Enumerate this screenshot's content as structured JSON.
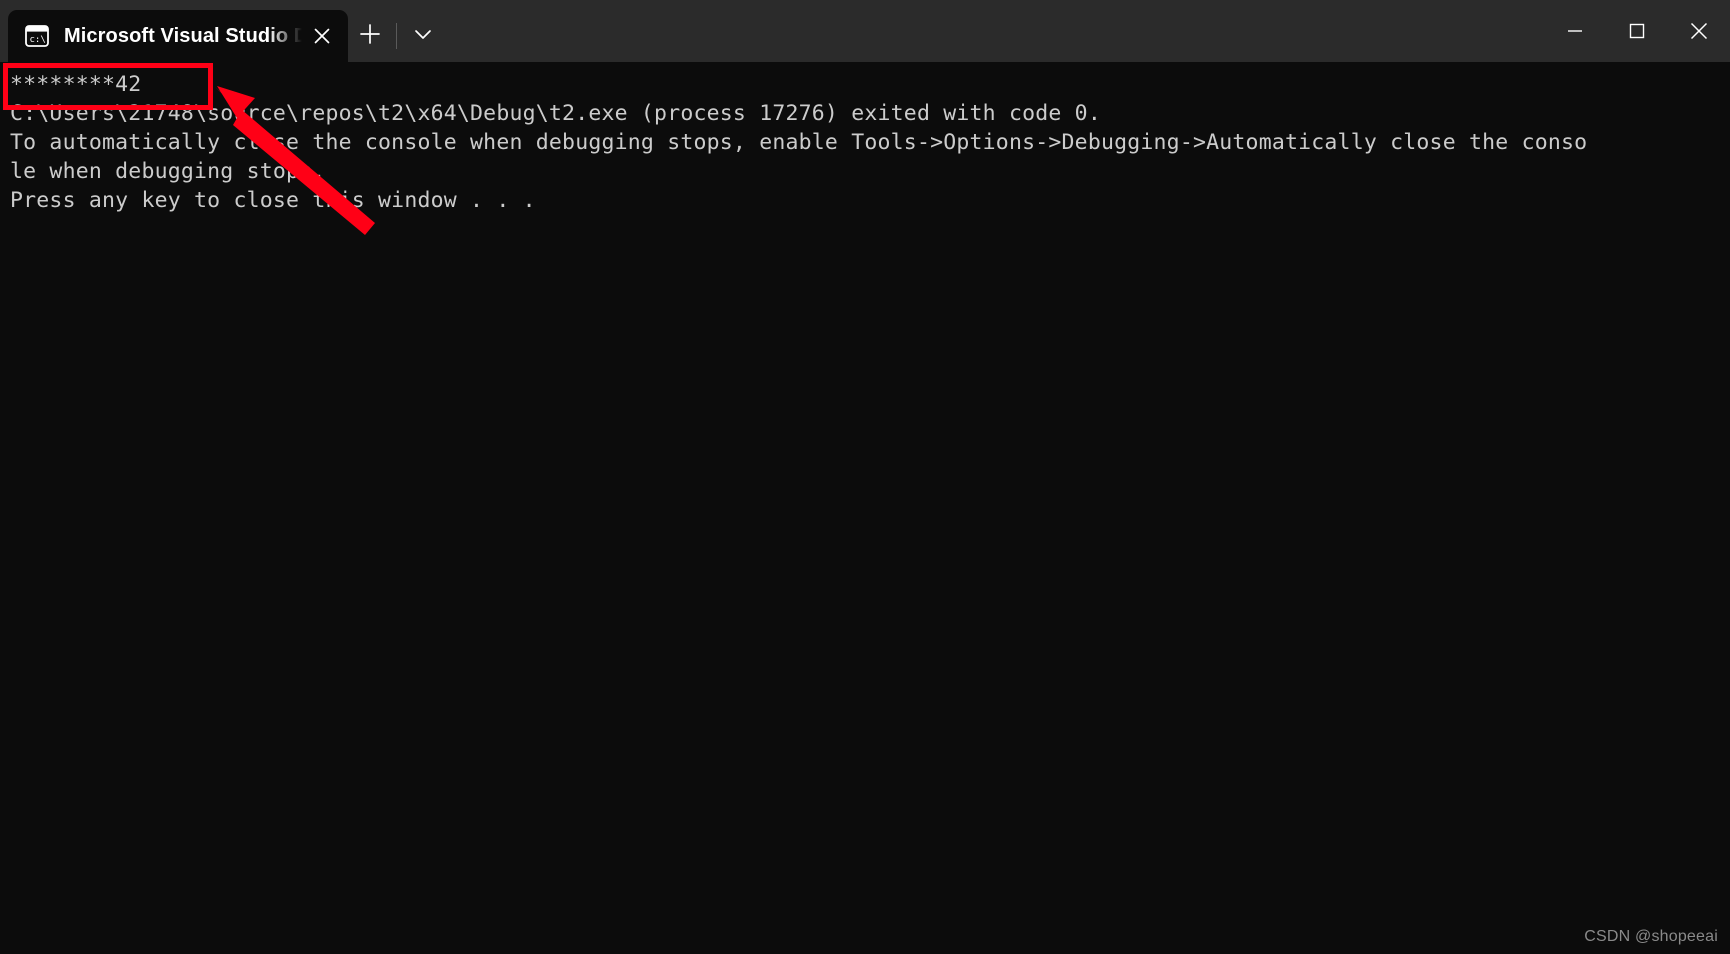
{
  "window": {
    "tab": {
      "title": "Microsoft Visual Studio Debug",
      "icon": "console-cmd-icon",
      "close_label": "Close tab"
    },
    "new_tab_label": "New tab",
    "dropdown_label": "Open a new tab dropdown",
    "minimize_label": "Minimize",
    "maximize_label": "Maximize",
    "close_label": "Close",
    "background_color": "#0c0c0c",
    "titlebar_color": "#2b2b2b",
    "text_color": "#cccccc"
  },
  "console": {
    "lines": [
      "********42",
      "C:\\Users\\21748\\source\\repos\\t2\\x64\\Debug\\t2.exe (process 17276) exited with code 0.",
      "To automatically close the console when debugging stops, enable Tools->Options->Debugging->Automatically close the conso",
      "le when debugging stops.",
      "Press any key to close this window . . ."
    ]
  },
  "annotation": {
    "highlight_color": "#ff0016",
    "target_text": "********42",
    "arrow_label": "red-arrow-pointing-to-output"
  },
  "watermark": {
    "text": "CSDN @shopeeai"
  }
}
